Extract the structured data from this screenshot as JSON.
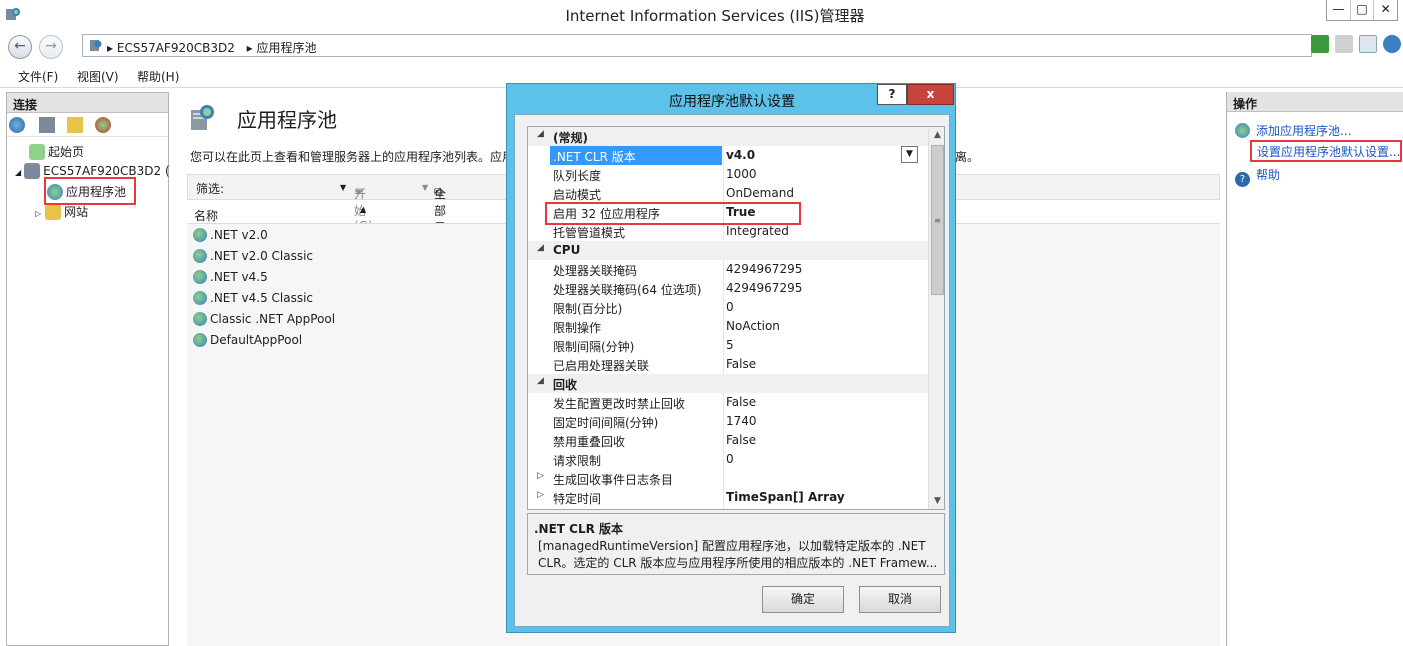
{
  "window": {
    "title": "Internet Information Services (IIS)管理器",
    "minimize": "—",
    "maximize": "□",
    "close": "✕"
  },
  "address": {
    "back": "←",
    "forward": "→",
    "sep": "▸",
    "crumbs": [
      "ECS57AF920CB3D2",
      "应用程序池"
    ]
  },
  "menu": {
    "file": "文件(F)",
    "view": "视图(V)",
    "help": "帮助(H)"
  },
  "connections": {
    "title": "连接",
    "tree": [
      {
        "label": "起始页"
      },
      {
        "label": "ECS57AF920CB3D2 ("
      },
      {
        "label": "应用程序池"
      },
      {
        "label": "网站"
      }
    ]
  },
  "center": {
    "heading": "应用程序池",
    "description": "您可以在此页上查看和管理服务器上的应用程序池列表。应用",
    "description_end": "离。",
    "filter_label": "筛选:",
    "start_label": "开始(G)",
    "show_all_label": "全部显示(A",
    "column_name": "名称",
    "pools": [
      ".NET v2.0",
      ".NET v2.0 Classic",
      ".NET v4.5",
      ".NET v4.5 Classic",
      "Classic .NET AppPool",
      "DefaultAppPool"
    ]
  },
  "actions": {
    "title": "操作",
    "items": [
      {
        "label": "添加应用程序池..."
      },
      {
        "label": "设置应用程序池默认设置..."
      },
      {
        "label": "帮助"
      }
    ]
  },
  "dialog": {
    "title": "应用程序池默认设置",
    "help_btn": "?",
    "close_btn": "x",
    "properties": [
      {
        "name": "(常规)",
        "value": "",
        "category": true
      },
      {
        "name": ".NET CLR 版本",
        "value": "v4.0",
        "bold": true,
        "selected": true
      },
      {
        "name": "队列长度",
        "value": "1000"
      },
      {
        "name": "启动模式",
        "value": "OnDemand"
      },
      {
        "name": "启用 32 位应用程序",
        "value": "True",
        "bold": true
      },
      {
        "name": "托管管道模式",
        "value": "Integrated"
      },
      {
        "name": "CPU",
        "value": "",
        "category": true
      },
      {
        "name": "处理器关联掩码",
        "value": "4294967295"
      },
      {
        "name": "处理器关联掩码(64 位选项)",
        "value": "4294967295"
      },
      {
        "name": "限制(百分比)",
        "value": "0"
      },
      {
        "name": "限制操作",
        "value": "NoAction"
      },
      {
        "name": "限制间隔(分钟)",
        "value": "5"
      },
      {
        "name": "已启用处理器关联",
        "value": "False"
      },
      {
        "name": "回收",
        "value": "",
        "category": true
      },
      {
        "name": "发生配置更改时禁止回收",
        "value": "False"
      },
      {
        "name": "固定时间间隔(分钟)",
        "value": "1740"
      },
      {
        "name": "禁用重叠回收",
        "value": "False"
      },
      {
        "name": "请求限制",
        "value": "0"
      },
      {
        "name": "生成回收事件日志条目",
        "value": "",
        "expandable": true
      },
      {
        "name": "特定时间",
        "value": "TimeSpan[] Array",
        "bold": true,
        "expandable": true
      }
    ],
    "desc_title": ".NET CLR 版本",
    "desc_line1": "[managedRuntimeVersion] 配置应用程序池，以加载特定版本的 .NET",
    "desc_line2": "CLR。选定的 CLR 版本应与应用程序所使用的相应版本的 .NET Framew...",
    "ok": "确定",
    "cancel": "取消"
  },
  "colors": {
    "dialog_frame": "#5dc2ea",
    "highlight": "#e8383d",
    "selection": "#3399ff",
    "link": "#1a56c4"
  }
}
